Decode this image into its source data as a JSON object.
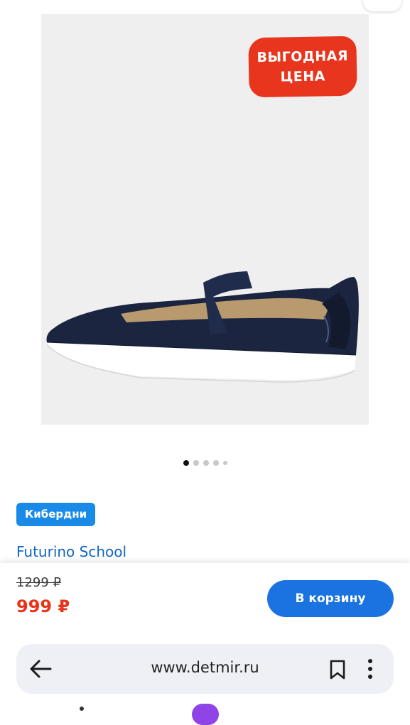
{
  "product": {
    "promo_badge_line1": "ВЫГОДНАЯ",
    "promo_badge_line2": "ЦЕНА",
    "gallery_total": 5,
    "gallery_active": 1,
    "promo_tag": "Кибердни",
    "brand": "Futurino School",
    "old_price": "1299 ₽",
    "price": "999 ₽",
    "add_to_cart_label": "В корзину"
  },
  "browser": {
    "url": "www.detmir.ru"
  },
  "icons": {
    "back": "back-arrow-icon",
    "bookmark": "bookmark-icon",
    "menu": "more-vert-icon"
  },
  "colors": {
    "accent_blue": "#1a73e0",
    "promo_tag_blue": "#1a8ae8",
    "price_red": "#e83418",
    "badge_red": "#e8361e",
    "link_blue": "#1266c4"
  }
}
